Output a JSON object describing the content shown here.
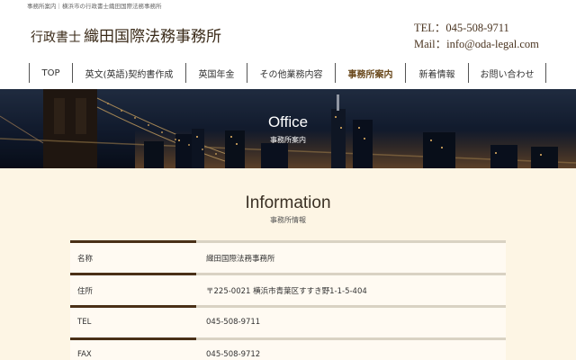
{
  "topbar": {
    "breadcrumb": "事務所案内｜横浜市の行政書士織田国際法務事務所"
  },
  "header": {
    "logo_small": "行政書士",
    "logo_big": "織田国際法務事務所",
    "tel": "TEL：045-508-9711",
    "mail": "Mail：info@oda-legal.com"
  },
  "nav": {
    "items": [
      {
        "label": "TOP"
      },
      {
        "label": "英文(英語)契約書作成"
      },
      {
        "label": "英国年金"
      },
      {
        "label": "その他業務内容"
      },
      {
        "label": "事務所案内"
      },
      {
        "label": "新着情報"
      },
      {
        "label": "お問い合わせ"
      }
    ],
    "active_index": 4
  },
  "hero": {
    "title": "Office",
    "subtitle": "事務所案内"
  },
  "section": {
    "title": "Information",
    "subtitle": "事務所情報"
  },
  "info": {
    "rows": [
      {
        "key": "名称",
        "value": "織田国際法務事務所"
      },
      {
        "key": "住所",
        "value": "〒225-0021 横浜市青葉区すすき野1-1-5-404"
      },
      {
        "key": "TEL",
        "value": "045-508-9711"
      },
      {
        "key": "FAX",
        "value": "045-508-9712"
      }
    ]
  },
  "colors": {
    "page_bg": "#fdf5e4",
    "accent_brown": "#4a3018",
    "hero_bg": "#0f1a2c"
  }
}
